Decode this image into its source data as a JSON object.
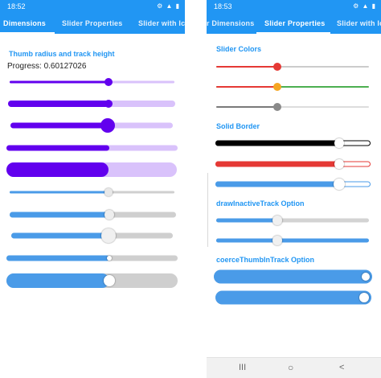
{
  "screen1": {
    "time": "18:52",
    "status_icons": "⚙ ▲ ▮",
    "tabs": [
      {
        "label": "Dimensions",
        "active": true
      },
      {
        "label": "Slider Properties",
        "active": false
      },
      {
        "label": "Slider with Ic",
        "active": false
      }
    ],
    "heading": "Thumb radius and track height",
    "progress_label": "Progress: 0.60127026"
  },
  "screen2": {
    "time": "18:53",
    "status_icons": "⚙ ▲ ▮",
    "tabs": [
      {
        "label": "r Dimensions",
        "active": false
      },
      {
        "label": "Slider Properties",
        "active": true
      },
      {
        "label": "Slider with Ic",
        "active": false
      }
    ],
    "sections": {
      "colors": "Slider Colors",
      "border": "Solid Border",
      "inactive": "drawInactiveTrack Option",
      "coerce": "coerceThumbInTrack Option"
    },
    "nav": {
      "recents": "III",
      "home": "○",
      "back": "<"
    }
  },
  "colors": {
    "accent": "#2196f3",
    "purple": "#6200ee",
    "purple_light": "#d9c2fb",
    "blue": "#4a9be8",
    "blue_light": "#90caf9",
    "grey_track": "#cfcfcf",
    "red": "#e53935",
    "orange": "#f5a623",
    "green": "#4caf50"
  },
  "sliders_screen1": [
    {
      "name": "purple-slider-1",
      "value": 0.6
    },
    {
      "name": "purple-slider-2",
      "value": 0.6
    },
    {
      "name": "purple-slider-3",
      "value": 0.6
    },
    {
      "name": "purple-slider-4",
      "value": 0.6
    },
    {
      "name": "purple-slider-5",
      "value": 0.6
    },
    {
      "name": "blue-slider-1",
      "value": 0.6
    },
    {
      "name": "blue-slider-2",
      "value": 0.6
    },
    {
      "name": "blue-slider-3",
      "value": 0.6
    },
    {
      "name": "blue-slider-4",
      "value": 0.6
    },
    {
      "name": "blue-slider-5",
      "value": 0.6
    }
  ],
  "sliders_screen2": [
    {
      "name": "color-slider-red",
      "value": 0.4
    },
    {
      "name": "color-slider-orange",
      "value": 0.4
    },
    {
      "name": "color-slider-grey",
      "value": 0.4
    },
    {
      "name": "border-slider-black",
      "value": 0.8
    },
    {
      "name": "border-slider-red",
      "value": 0.8
    },
    {
      "name": "border-slider-blue",
      "value": 0.8
    },
    {
      "name": "inactive-slider-1",
      "value": 0.4
    },
    {
      "name": "inactive-slider-2",
      "value": 0.4
    },
    {
      "name": "coerce-slider-1",
      "value": 1.0
    },
    {
      "name": "coerce-slider-2",
      "value": 1.0
    }
  ]
}
